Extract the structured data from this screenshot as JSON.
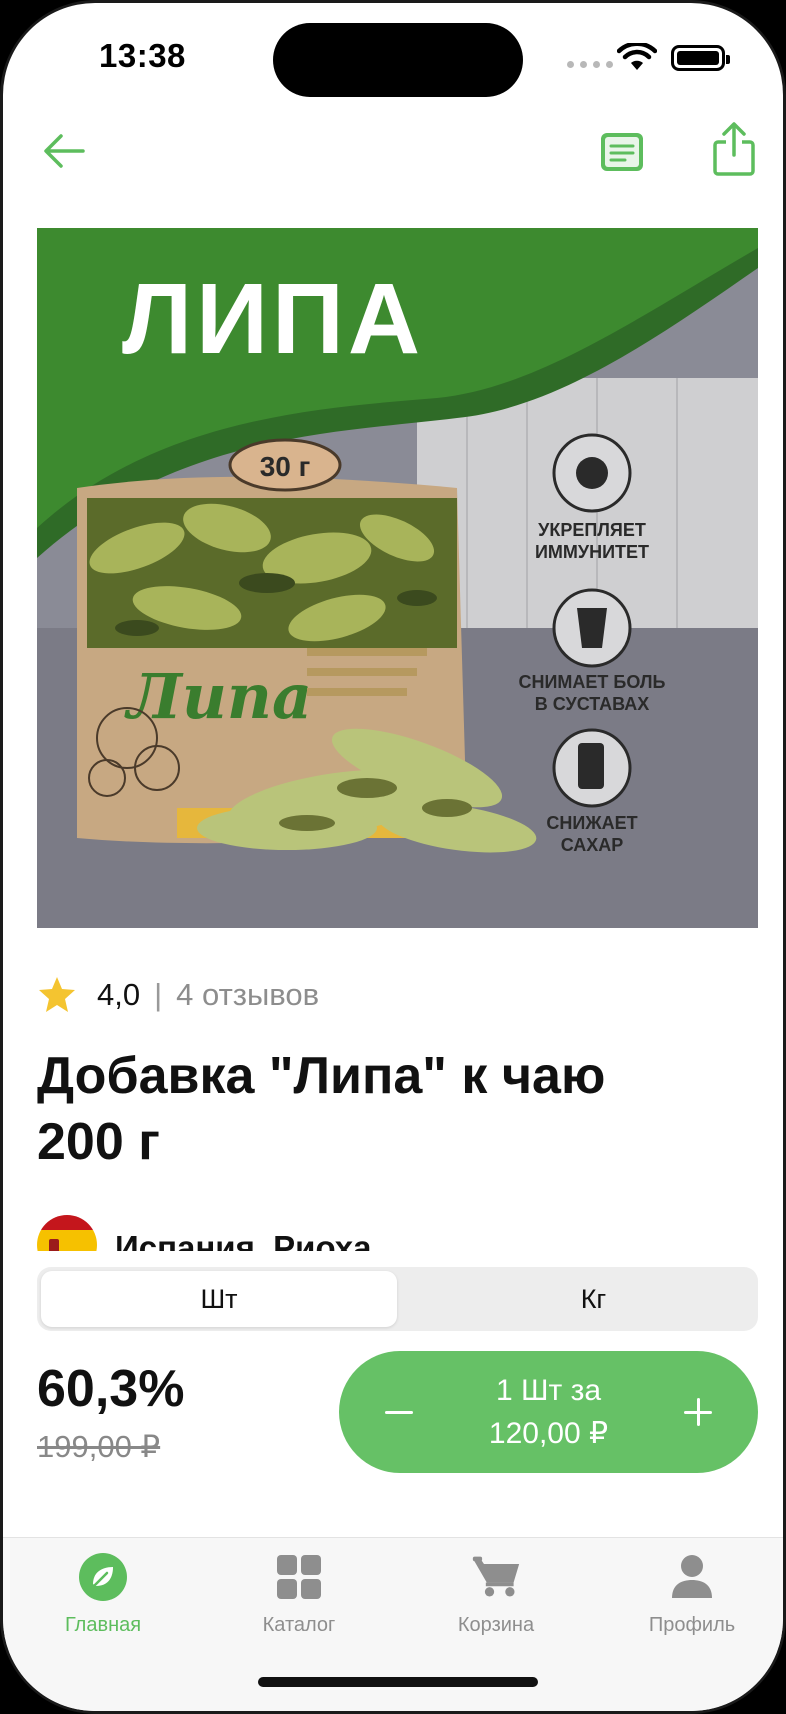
{
  "status_bar": {
    "time": "13:38"
  },
  "header": {
    "back_icon": "arrow-left-icon",
    "document_icon": "document-icon",
    "share_icon": "share-icon",
    "accent_color": "#5dbd5d"
  },
  "product": {
    "image": {
      "banner_title": "ЛИПА",
      "weight_badge": "30 г",
      "package_label": "Липа",
      "benefits": [
        "УКРЕПЛЯЕТ ИММУНИТЕТ",
        "СНИМАЕТ БОЛЬ В СУСТАВАХ",
        "СНИЖАЕТ САХАР"
      ]
    },
    "rating": {
      "icon": "star-icon",
      "value": "4,0",
      "separator": "|",
      "reviews": "4 отзывов"
    },
    "title_line1": "Добавка \"Липа\" к чаю",
    "title_line2": "200 г",
    "origin": {
      "flag_icon": "spain-flag-icon",
      "text": "Испания, Риоха"
    }
  },
  "purchase": {
    "units": [
      {
        "label": "Шт",
        "selected": true
      },
      {
        "label": "Кг",
        "selected": false
      }
    ],
    "discount": "60,3%",
    "old_price": "199,00 ₽",
    "cart": {
      "minus_icon": "minus-icon",
      "plus_icon": "plus-icon",
      "line1": "1 Шт за",
      "line2": "120,00 ₽",
      "color": "#66c166"
    }
  },
  "tab_bar": {
    "tabs": [
      {
        "label": "Главная",
        "icon": "leaf-icon",
        "active": true
      },
      {
        "label": "Каталог",
        "icon": "grid-icon",
        "active": false
      },
      {
        "label": "Корзина",
        "icon": "cart-icon",
        "active": false
      },
      {
        "label": "Профиль",
        "icon": "person-icon",
        "active": false
      }
    ]
  }
}
